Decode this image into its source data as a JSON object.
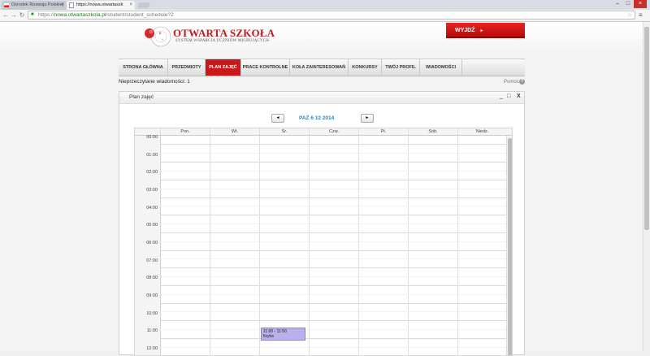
{
  "browser": {
    "tabs": [
      {
        "title": "Ośrodek Rozwoju Polskiej"
      },
      {
        "title": "https://nowa.otwartaszk"
      }
    ],
    "url_host": "nowa.otwartaszkola.pl",
    "url_path": "/student/student_schedule?2",
    "url_scheme": "https://"
  },
  "header": {
    "logo_title": "OTWARTA SZKOŁA",
    "logo_subtitle": "SYSTEM WSPARCIA UCZNIÓW MIGRUJĄCYCH",
    "logout_label": "WYJDŹ",
    "brand_color": "#c8181a"
  },
  "nav": {
    "items": [
      {
        "label": "STRONA GŁÓWNA"
      },
      {
        "label": "PRZEDMIOTY"
      },
      {
        "label": "PLAN ZAJĘĆ",
        "active": true
      },
      {
        "label": "PRACE KONTROLNE"
      },
      {
        "label": "KOŁA ZAINTERESOWAŃ"
      },
      {
        "label": "KONKURSY"
      },
      {
        "label": "TWÓJ PROFIL"
      },
      {
        "label": "WIADOMOŚCI"
      }
    ]
  },
  "messages": {
    "unread_label": "Nieprzeczytane wiadomości: 1"
  },
  "help": {
    "label": "Pomoc"
  },
  "panel": {
    "title": "Plan zajęć",
    "controls": {
      "minimize": "_",
      "maximize": "□",
      "close": "X"
    }
  },
  "calendar": {
    "prev_label": "◄",
    "next_label": "►",
    "date_range": "PAŹ 6  12 2014",
    "days": [
      "Pon.",
      "Wt.",
      "Śr.",
      "Czw.",
      "Pt.",
      "Sob.",
      "Niedz."
    ],
    "hours": [
      "00:00",
      "01:00",
      "02:00",
      "03:00",
      "04:00",
      "05:00",
      "06:00",
      "07:00",
      "08:00",
      "09:00",
      "10:00",
      "11:00",
      "12:00"
    ],
    "event": {
      "time": "11:00 - 11:50",
      "title": "fizyka",
      "day": "Śr.",
      "color": "#b9b0ec"
    }
  }
}
